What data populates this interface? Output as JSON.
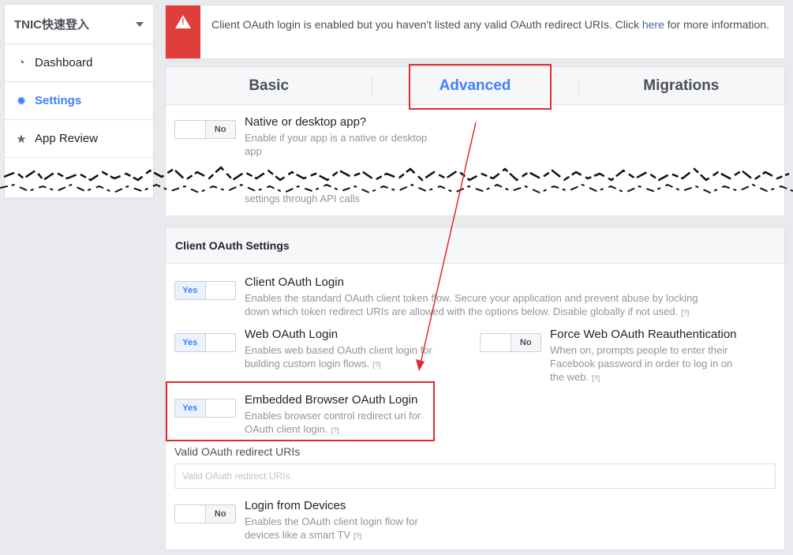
{
  "sidebar": {
    "app_name": "TNIC快速登入",
    "items": [
      {
        "label": "Dashboard",
        "icon": "dashboard-icon"
      },
      {
        "label": "Settings",
        "icon": "gear-icon",
        "active": true
      },
      {
        "label": "App Review",
        "icon": "star-icon"
      }
    ]
  },
  "alert": {
    "text": "Client OAuth login is enabled but you haven't listed any valid OAuth redirect URIs. Click",
    "link": "here",
    "text_after": " for more information.",
    "color": "#e03d3d"
  },
  "tabs": [
    {
      "label": "Basic"
    },
    {
      "label": "Advanced",
      "active": true
    },
    {
      "label": "Migrations"
    }
  ],
  "native": {
    "title": "Native or desktop app?",
    "desc": "Enable if your app is a native or desktop app",
    "toggle": "No"
  },
  "api_settings": {
    "desc_tail": "settings through API calls"
  },
  "oauth": {
    "heading": "Client OAuth Settings",
    "client_login": {
      "title": "Client OAuth Login",
      "desc": "Enables the standard OAuth client token flow. Secure your application and prevent abuse by locking down which token redirect URIs are allowed with the options below. Disable globally if not used.",
      "toggle": "Yes"
    },
    "web_login": {
      "title": "Web OAuth Login",
      "desc": "Enables web based OAuth client login for building custom login flows.",
      "toggle": "Yes"
    },
    "force_reauth": {
      "title": "Force Web OAuth Reauthentication",
      "desc": "When on, prompts people to enter their Facebook password in order to log in on the web.",
      "toggle": "No"
    },
    "embedded": {
      "title": "Embedded Browser OAuth Login",
      "desc": "Enables browser control redirect uri for OAuth client login.",
      "toggle": "Yes"
    },
    "redirect_label": "Valid OAuth redirect URIs",
    "redirect_placeholder": "Valid OAuth redirect URIs.",
    "devices": {
      "title": "Login from Devices",
      "desc": "Enables the OAuth client login flow for devices like a smart TV",
      "toggle": "No"
    },
    "help_marker": "[?]"
  },
  "annotation_color": "#e02b2b",
  "accent": "#4080ff"
}
